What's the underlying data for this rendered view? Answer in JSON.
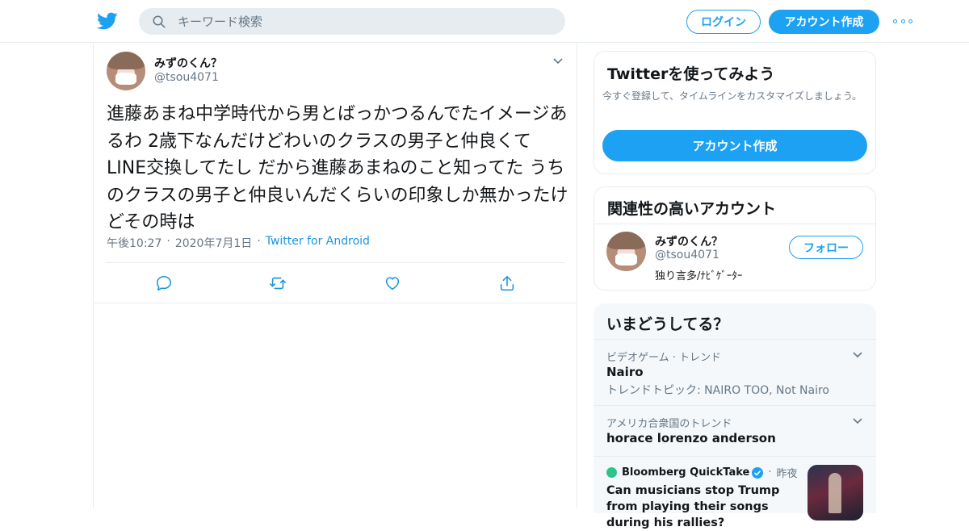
{
  "header": {
    "search_placeholder": "キーワード検索",
    "login_label": "ログイン",
    "signup_label": "アカウント作成"
  },
  "tweet": {
    "user_name": "みずのくん？",
    "user_handle": "@tsou4071",
    "text": "進藤あまね中学時代から男とばっかつるんでたイメージあるわ 2歳下なんだけどわいのクラスの男子と仲良くてLINE交換してたし だから進藤あまねのこと知ってた うちのクラスの男子と仲良いんだくらいの印象しか無かったけどその時は",
    "time": "午後10:27",
    "date": "2020年7月1日",
    "source": "Twitter for Android",
    "sep": "·"
  },
  "signup_card": {
    "title": "Twitterを使ってみよう",
    "description": "今すぐ登録して、タイムラインをカスタマイズしましょう。",
    "button": "アカウント作成"
  },
  "related": {
    "title": "関連性の高いアカウント",
    "name": "みずのくん？",
    "handle": "@tsou4071",
    "bio": "独り言多/ﾅﾋﾞｹﾞｰﾀｰ",
    "follow": "フォロー"
  },
  "trends": {
    "title": "いまどうしてる？",
    "items": [
      {
        "category": "ビデオゲーム · トレンド",
        "name": "Nairo",
        "sub": "トレンドトピック: NAIRO TOO, Not Nairo"
      },
      {
        "category": "アメリカ合衆国のトレンド",
        "name": "horace lorenzo anderson"
      }
    ],
    "news": {
      "source": "Bloomberg QuickTake",
      "sep": "·",
      "time": "昨夜",
      "headline": "Can musicians stop Trump from playing their songs during his rallies?"
    }
  },
  "colors": {
    "accent": "#1da1f2",
    "muted": "#657786",
    "border": "#e6ecf0"
  },
  "icons": [
    "twitter-bird-icon",
    "search-icon",
    "more-icon",
    "chevron-down-icon",
    "reply-icon",
    "retweet-icon",
    "like-icon",
    "share-icon",
    "verified-icon"
  ]
}
